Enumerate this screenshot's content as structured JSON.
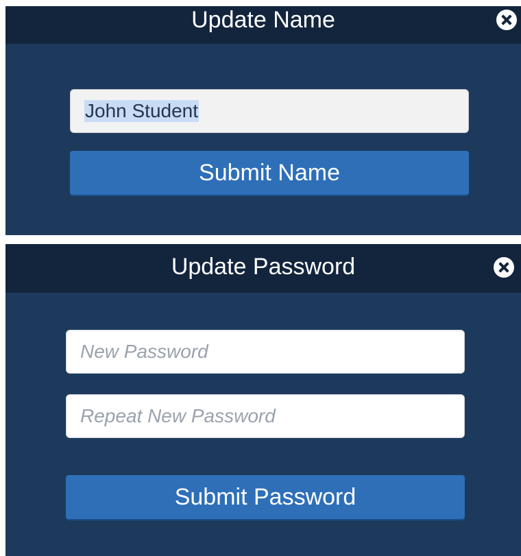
{
  "update_name": {
    "title": "Update Name",
    "name_value": "John Student",
    "submit_label": "Submit Name"
  },
  "update_password": {
    "title": "Update Password",
    "new_password_placeholder": "New Password",
    "repeat_password_placeholder": "Repeat New Password",
    "submit_label": "Submit Password"
  },
  "icons": {
    "close": "close-icon"
  },
  "colors": {
    "panel_bg": "#1d3a5c",
    "header_bg": "#13253d",
    "button_bg": "#2e6fb8",
    "selection_highlight": "#c9dcf5"
  }
}
